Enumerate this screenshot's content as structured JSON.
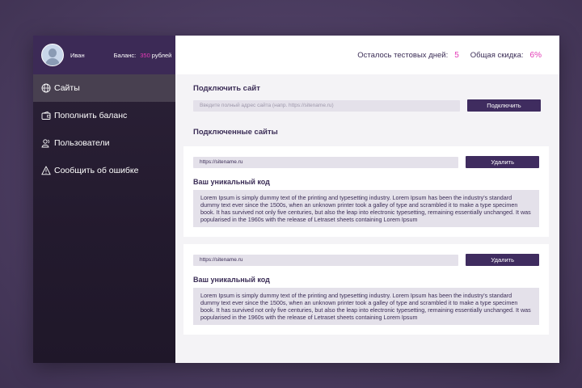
{
  "profile": {
    "name": "Иван",
    "balance_label": "Баланс:",
    "balance_value": "350",
    "balance_unit": "рублей"
  },
  "nav": {
    "items": [
      {
        "label": "Сайты",
        "icon": "globe-icon",
        "active": true
      },
      {
        "label": "Пополнить баланс",
        "icon": "wallet-icon",
        "active": false
      },
      {
        "label": "Пользователи",
        "icon": "users-icon",
        "active": false
      },
      {
        "label": "Сообщить об ошибке",
        "icon": "warning-icon",
        "active": false
      }
    ]
  },
  "topbar": {
    "trial_label": "Осталось тестовых дней:",
    "trial_value": "5",
    "discount_label": "Общая скидка:",
    "discount_value": "6%"
  },
  "connect": {
    "title": "Подключить сайт",
    "placeholder": "Введите полный адрес сайта (напр. https://sitename.ru)",
    "button": "Подключить"
  },
  "connected": {
    "title": "Подключенные сайты",
    "sites": [
      {
        "url": "https://sitename.ru",
        "delete_label": "Удалить",
        "code_title": "Ваш уникальный код",
        "code": "Lorem Ipsum is simply dummy text of the printing and typesetting industry. Lorem Ipsum has been the industry's standard dummy text ever since the 1500s, when an unknown printer took a galley of type and scrambled it to make a type specimen book. It has survived not only five centuries, but also the leap into electronic typesetting, remaining essentially unchanged. It was popularised in the 1960s with the release of Letraset sheets containing Lorem Ipsum"
      },
      {
        "url": "https://sitename.ru",
        "delete_label": "Удалить",
        "code_title": "Ваш уникальный код",
        "code": "Lorem Ipsum is simply dummy text of the printing and typesetting industry. Lorem Ipsum has been the industry's standard dummy text ever since the 1500s, when an unknown printer took a galley of type and scrambled it to make a type specimen book. It has survived not only five centuries, but also the leap into electronic typesetting, remaining essentially unchanged. It was popularised in the 1960s with the release of Letraset sheets containing Lorem Ipsum"
      }
    ]
  },
  "colors": {
    "accent": "#3f2c5f",
    "highlight": "#e33ab6",
    "sidebar": "#231a2e"
  }
}
